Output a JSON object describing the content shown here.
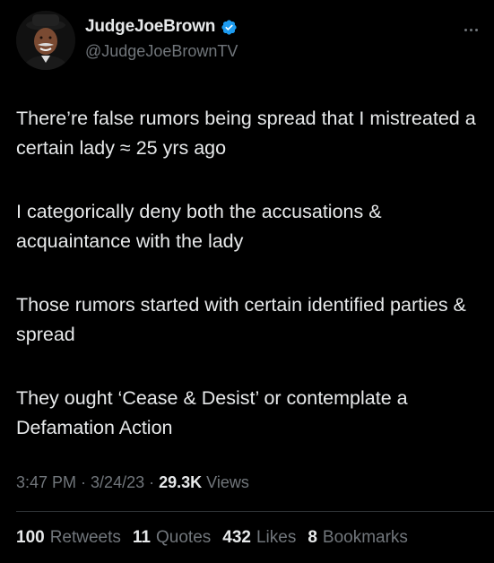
{
  "author": {
    "display_name": "JudgeJoeBrown",
    "handle": "@JudgeJoeBrownTV",
    "verified": true,
    "verified_color": "#1d9bf0",
    "avatar_icon": "profile-photo"
  },
  "tweet": {
    "paragraphs": [
      "There’re false rumors being spread that I mistreated a certain lady ≈ 25 yrs ago",
      "I categorically deny both the accusations & acquaintance with the lady",
      "Those rumors started with certain identified parties & spread",
      "They ought ‘Cease & Desist’ or contemplate a Defamation Action"
    ]
  },
  "meta": {
    "time": "3:47 PM",
    "separator": " · ",
    "date": "3/24/23",
    "views_count": "29.3K",
    "views_label": "Views"
  },
  "stats": {
    "retweets_count": "100",
    "retweets_label": "Retweets",
    "quotes_count": "11",
    "quotes_label": "Quotes",
    "likes_count": "432",
    "likes_label": "Likes",
    "bookmarks_count": "8",
    "bookmarks_label": "Bookmarks"
  },
  "colors": {
    "background": "#000000",
    "primary_text": "#e7e9ea",
    "secondary_text": "#71767b",
    "divider": "#2f3336"
  }
}
